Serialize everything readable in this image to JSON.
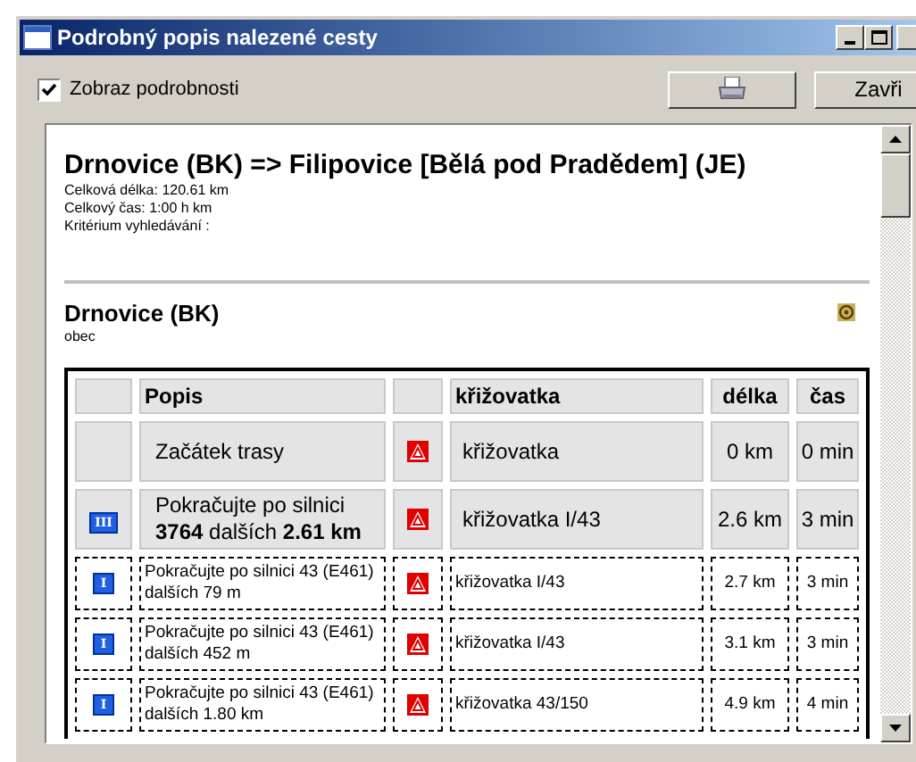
{
  "window": {
    "title": "Podrobný popis nalezené cesty"
  },
  "toolbar": {
    "show_details": {
      "label": "Zobraz podrobnosti",
      "checked": true
    },
    "close_button": "Zavři"
  },
  "route": {
    "title": "Drnovice (BK) => Filipovice [Bělá pod Pradědem] (JE)",
    "lines": [
      "Celková délka: 120.61 km",
      "Celkový čas: 1:00 h km",
      "Kritérium vyhledávání :"
    ]
  },
  "section": {
    "title": "Drnovice (BK)",
    "subtitle": "obec"
  },
  "table": {
    "columns": [
      "Popis",
      "křižovatka",
      "délka",
      "čas"
    ],
    "rows": [
      {
        "kind": "plain",
        "road_class": null,
        "description": "Začátek trasy",
        "junction": "křižovatka",
        "length": "0 km",
        "time": "0 min"
      },
      {
        "kind": "plain",
        "road_class": "III",
        "description": "Pokračujte po silnici **3764** dalších **2.61 km**",
        "junction": "křižovatka I/43",
        "length": "2.6 km",
        "time": "3 min"
      },
      {
        "kind": "dotted",
        "road_class": "I",
        "description": "Pokračujte po silnici 43 (E461) dalších 79 m",
        "junction": "křižovatka I/43",
        "length": "2.7 km",
        "time": "3 min"
      },
      {
        "kind": "dotted",
        "road_class": "I",
        "description": "Pokračujte po silnici 43 (E461) dalších 452 m",
        "junction": "křižovatka I/43",
        "length": "3.1 km",
        "time": "3 min"
      },
      {
        "kind": "dotted",
        "road_class": "I",
        "description": "Pokračujte po silnici 43 (E461) dalších 1.80 km",
        "junction": "křižovatka 43/150",
        "length": "4.9 km",
        "time": "4 min"
      }
    ]
  }
}
